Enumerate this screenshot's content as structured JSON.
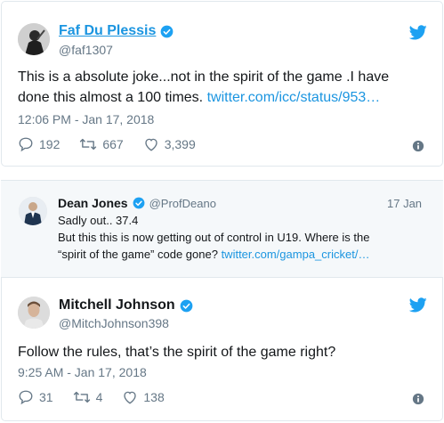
{
  "tweet1": {
    "display_name": "Faf Du Plessis",
    "handle": "@faf1307",
    "text": "This is a absolute joke...not in the spirit of the game .I have done this almost a 100 times.",
    "link_text": "twitter.com/icc/status/953…",
    "timestamp": "12:06 PM - Jan 17, 2018",
    "replies": "192",
    "retweets": "667",
    "likes": "3,399"
  },
  "reply": {
    "display_name": "Dean Jones",
    "handle": "@ProfDeano",
    "date": "17 Jan",
    "line1": "Sadly out.. 37.4",
    "line2": "But this this is now getting out of control in U19. Where is the",
    "line3_text": "“spirit of the game” code gone?",
    "link_text": "twitter.com/gampa_cricket/…"
  },
  "tweet2": {
    "display_name": "Mitchell Johnson",
    "handle": "@MitchJohnson398",
    "text": "Follow the rules, that’s the spirit of the game right?",
    "timestamp": "9:25 AM - Jan 17, 2018",
    "replies": "31",
    "retweets": "4",
    "likes": "138"
  },
  "colors": {
    "twitter_blue": "#1da1f2",
    "link_blue": "#1b95e0",
    "muted_gray": "#657786",
    "reply_bg": "#f5f8fa"
  }
}
